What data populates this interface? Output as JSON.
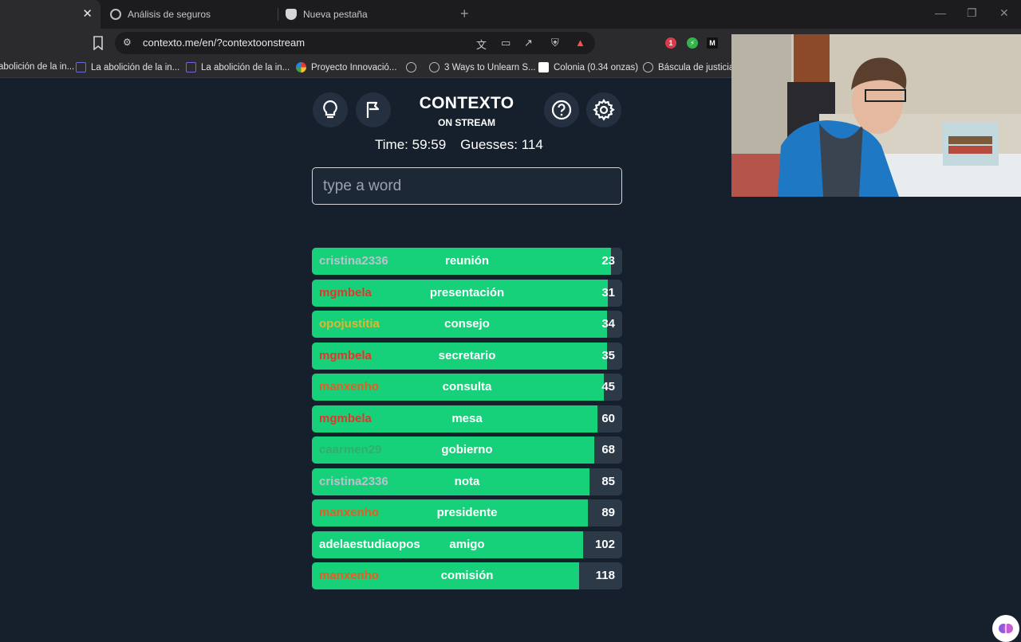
{
  "browser": {
    "tabs": [
      {
        "label": "",
        "active": true
      },
      {
        "label": "Análisis de seguros",
        "active": false
      },
      {
        "label": "Nueva pestaña",
        "active": false
      }
    ],
    "close_glyph": "✕",
    "newtab_glyph": "+",
    "url": "contexto.me/en/?contextoonstream",
    "bookmarks": [
      "abolición de la in...",
      "La abolición de la in...",
      "La abolición de la in...",
      "Proyecto Innovació...",
      "",
      "3 Ways to Unlearn S...",
      "Colonia (0.34 onzas)",
      "Báscula de justicia..."
    ],
    "extension_badge": "1",
    "extension_m": "M"
  },
  "game": {
    "title": "CONTEXTO",
    "subtitle": "ON STREAM",
    "time_label": "Time:",
    "time_value": "59:59",
    "guesses_label": "Guesses:",
    "guesses_value": "114",
    "input_placeholder": "type a word",
    "guesses": [
      {
        "user": "cristina2336",
        "user_color": "#b9c2cc",
        "word": "reunión",
        "rank": "23",
        "fill": 0.965
      },
      {
        "user": "mgmbela",
        "user_color": "#e8322a",
        "word": "presentación",
        "rank": "31",
        "fill": 0.955
      },
      {
        "user": "opojustitia",
        "user_color": "#e3b62e",
        "word": "consejo",
        "rank": "34",
        "fill": 0.95
      },
      {
        "user": "mgmbela",
        "user_color": "#e8322a",
        "word": "secretario",
        "rank": "35",
        "fill": 0.95
      },
      {
        "user": "manxenho",
        "user_color": "#ea5a23",
        "word": "consulta",
        "rank": "45",
        "fill": 0.94
      },
      {
        "user": "mgmbela",
        "user_color": "#e8322a",
        "word": "mesa",
        "rank": "60",
        "fill": 0.92
      },
      {
        "user": "caarmen29",
        "user_color": "#2fb06a",
        "word": "gobierno",
        "rank": "68",
        "fill": 0.91
      },
      {
        "user": "cristina2336",
        "user_color": "#b9c2cc",
        "word": "nota",
        "rank": "85",
        "fill": 0.895
      },
      {
        "user": "manxenho",
        "user_color": "#ea5a23",
        "word": "presidente",
        "rank": "89",
        "fill": 0.89
      },
      {
        "user": "adelaestudiaopos",
        "user_color": "#ffffff",
        "word": "amigo",
        "rank": "102",
        "fill": 0.875
      },
      {
        "user": "manxenho",
        "user_color": "#ea5a23",
        "word": "comisión",
        "rank": "118",
        "fill": 0.86
      }
    ]
  }
}
